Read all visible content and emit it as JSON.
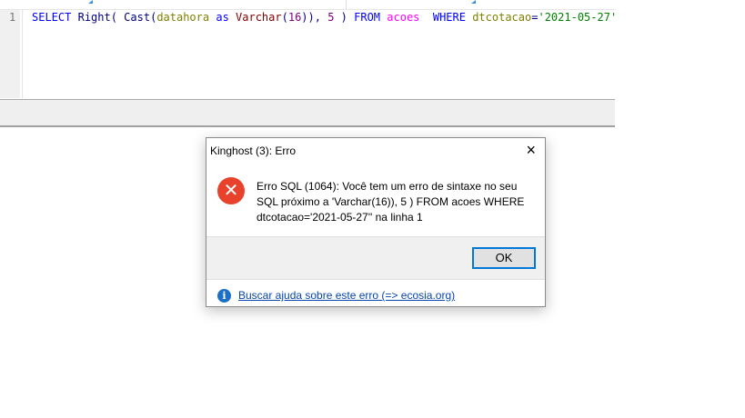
{
  "editor": {
    "line_number": "1",
    "tokens": {
      "select": "SELECT",
      "right": "Right",
      "p1": "( ",
      "cast": "Cast",
      "p2": "(",
      "datahora": "datahora",
      "as": "as",
      "varchar": "Varchar",
      "p3": "(",
      "n16": "16",
      "p4": ")), ",
      "n5": "5",
      "p5": " ) ",
      "from": "FROM",
      "acoes": "acoes",
      "where": "WHERE",
      "dtcotacao": "dtcotacao",
      "eq": "=",
      "date": "'2021-05-27'"
    }
  },
  "dialog": {
    "title": "Kinghost (3): Erro",
    "close_icon": "×",
    "error_icon": "✕",
    "message": "Erro SQL (1064): Você tem um erro de sintaxe no seu SQL próximo a 'Varchar(16)), 5 ) FROM acoes WHERE dtcotacao='2021-05-27'' na linha 1",
    "ok_label": "OK",
    "info_icon": "i",
    "help_link": "Buscar ajuda sobre este erro (=> ecosia.org)"
  }
}
